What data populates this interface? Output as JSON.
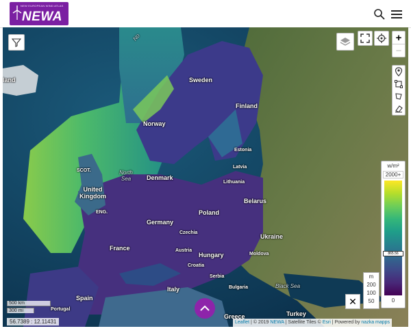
{
  "header": {
    "logo_tagline": "NEW EUROPEAN WIND ATLAS",
    "logo_text": "NEWA",
    "icons": [
      "search-icon",
      "menu-icon"
    ]
  },
  "map": {
    "labels": {
      "norway_sea": "No",
      "iceland": "land",
      "sweden": "Sweden",
      "finland": "Finland",
      "norway": "Norway",
      "estonia": "Estonia",
      "latvia": "Latvia",
      "lithuania": "Lithuania",
      "scotland": "SCOT.",
      "north_sea": "North\nSea",
      "denmark": "Denmark",
      "uk": "United\nKingdom",
      "england": "ENG.",
      "belarus": "Belarus",
      "poland": "Poland",
      "germany": "Germany",
      "czechia": "Czechia",
      "ukraine": "Ukraine",
      "france": "France",
      "austria": "Austria",
      "hungary": "Hungary",
      "moldova": "Moldova",
      "croatia": "Croatia",
      "serbia": "Serbia",
      "black_sea": "Black Sea",
      "italy": "Italy",
      "bulgaria": "Bulgaria",
      "spain": "Spain",
      "portugal": "Portugal",
      "greece": "Greece",
      "turkey": "Turkey"
    },
    "scale": {
      "km": "500 km",
      "mi": "300 mi"
    },
    "coordinates": "56.7389 : 12.11431"
  },
  "legend": {
    "unit": "w/m²",
    "max": "2000+",
    "marker": "865.56",
    "min": "0"
  },
  "elevation": {
    "unit": "m",
    "values": [
      "200",
      "100",
      "50"
    ]
  },
  "attribution": {
    "leaflet": "Leaflet",
    "copyright": " | © 2019 ",
    "newa": "NEWA",
    "sat": " | Satellite Tiles © ",
    "esri": "Esri",
    "powered": " | Powered by ",
    "nazka": "nazka mapps"
  },
  "colors": {
    "brand": "#7b1fa2",
    "fab": "#8e24aa",
    "link": "#0078a8"
  }
}
